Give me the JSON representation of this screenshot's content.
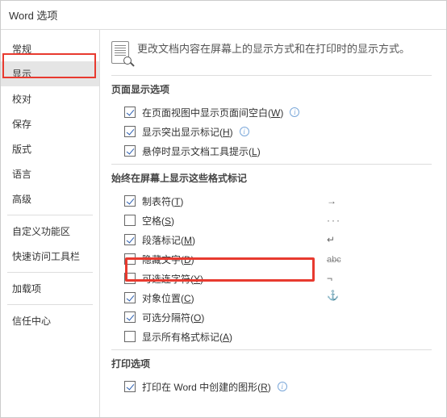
{
  "title": "Word 选项",
  "sidebar": {
    "items": [
      {
        "label": "常规"
      },
      {
        "label": "显示"
      },
      {
        "label": "校对"
      },
      {
        "label": "保存"
      },
      {
        "label": "版式"
      },
      {
        "label": "语言"
      },
      {
        "label": "高级"
      },
      {
        "label": "自定义功能区"
      },
      {
        "label": "快速访问工具栏"
      },
      {
        "label": "加载项"
      },
      {
        "label": "信任中心"
      }
    ],
    "selected_index": 1
  },
  "description": "更改文档内容在屏幕上的显示方式和在打印时的显示方式。",
  "sections": [
    {
      "title": "页面显示选项",
      "options": [
        {
          "checked": true,
          "label": "在页面视图中显示页面间空白(",
          "key": "W",
          "suffix": ")",
          "info": true
        },
        {
          "checked": true,
          "label": "显示突出显示标记(",
          "key": "H",
          "suffix": ")",
          "info": true
        },
        {
          "checked": true,
          "label": "悬停时显示文档工具提示(",
          "key": "L",
          "suffix": ")"
        }
      ]
    },
    {
      "title": "始终在屏幕上显示这些格式标记",
      "options": [
        {
          "checked": true,
          "label": "制表符(",
          "key": "T",
          "suffix": ")",
          "symbol": "→"
        },
        {
          "checked": false,
          "label": "空格(",
          "key": "S",
          "suffix": ")",
          "symbol": "..."
        },
        {
          "checked": true,
          "label": "段落标记(",
          "key": "M",
          "suffix": ")",
          "symbol": "↵"
        },
        {
          "checked": false,
          "label": "隐藏文字(",
          "key": "D",
          "suffix": ")",
          "symbol": "abc"
        },
        {
          "checked": false,
          "label": "可选连字符(",
          "key": "Y",
          "suffix": ")",
          "symbol": "¬"
        },
        {
          "checked": true,
          "label": "对象位置(",
          "key": "C",
          "suffix": ")",
          "symbol": "anchor"
        },
        {
          "checked": true,
          "label": "可选分隔符(",
          "key": "O",
          "suffix": ")",
          "symbol": ""
        },
        {
          "checked": false,
          "label": "显示所有格式标记(",
          "key": "A",
          "suffix": ")"
        }
      ]
    },
    {
      "title": "打印选项",
      "options": [
        {
          "checked": true,
          "label": "打印在 Word 中创建的图形(",
          "key": "R",
          "suffix": ")",
          "info": true
        }
      ]
    }
  ]
}
